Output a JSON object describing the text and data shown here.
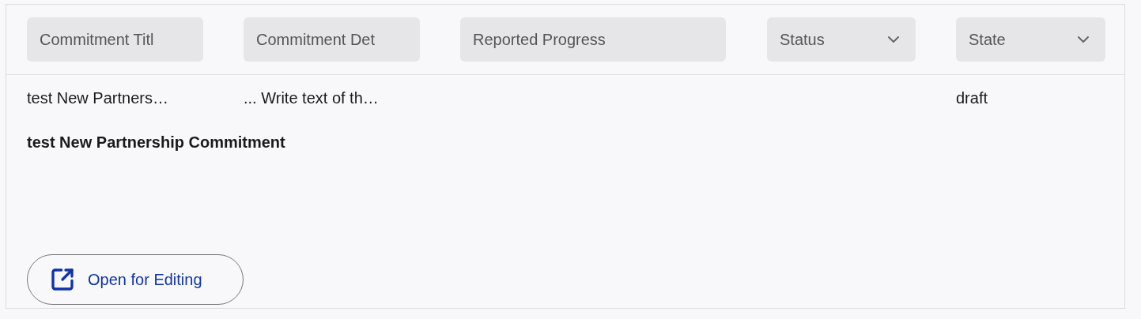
{
  "filters": [
    {
      "kind": "text",
      "placeholder": "Commitment Titl"
    },
    {
      "kind": "text",
      "placeholder": "Commitment Det"
    },
    {
      "kind": "text",
      "placeholder": "Reported Progress"
    },
    {
      "kind": "select",
      "placeholder": "Status"
    },
    {
      "kind": "select",
      "placeholder": "State"
    }
  ],
  "row": {
    "commitment_title": "test New Partners…",
    "commitment_details": "... Write text of th…",
    "state": "draft"
  },
  "detail": {
    "title": "test New Partnership Commitment",
    "button": "Open for Editing"
  }
}
